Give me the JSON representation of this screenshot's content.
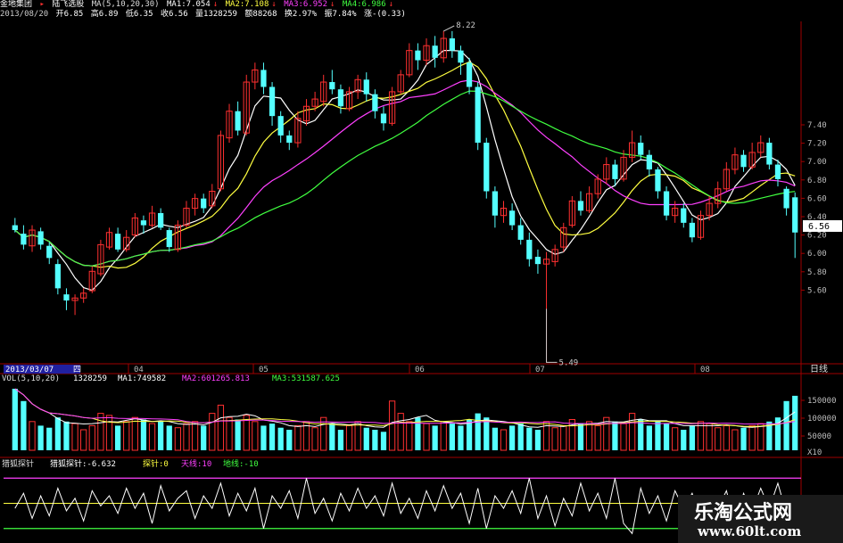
{
  "header": {
    "line1": {
      "name": "金地集团",
      "formula": "陆飞选股",
      "ma_spec": "MA(5,10,20,30)",
      "ma1": "MA1:7.054",
      "ma2": "MA2:7.108",
      "ma3": "MA3:6.952",
      "ma4": "MA4:6.986"
    },
    "line2": {
      "date": "2013/08/20",
      "open": "开6.85",
      "high": "高6.89",
      "low": "低6.35",
      "close": "收6.56",
      "vol": "量1328259",
      "amount": "额88268",
      "turnover": "换2.97%",
      "amplitude": "振7.84%",
      "change": "涨-(0.33)"
    }
  },
  "price_axis": {
    "ticks": [
      "7.40",
      "7.20",
      "7.00",
      "6.80",
      "6.60",
      "6.40",
      "6.20",
      "6.00",
      "5.80",
      "5.60"
    ],
    "current": "6.56"
  },
  "price_annotations": {
    "high": "8.22",
    "low": "5.49"
  },
  "time_axis": {
    "start": "2013/03/07",
    "weekday": "四",
    "months": [
      "04",
      "05",
      "06",
      "07",
      "08"
    ],
    "period": "日线"
  },
  "volume_panel": {
    "header": "VOL(5,10,20)",
    "vol": "1328259",
    "ma1": "MA1:749582",
    "ma2": "MA2:601265.813",
    "ma3": "MA3:531587.625",
    "ticks": [
      "150000",
      "100000",
      "50000"
    ],
    "unit": "X10"
  },
  "indicator_panel": {
    "name": "猎狐探针",
    "value": "猎狐探针:-6.632",
    "probe": "探针:0",
    "sky": "天线:10",
    "ground": "地线:-10"
  },
  "watermark": {
    "title": "乐淘公式网",
    "url": "www.60lt.com"
  },
  "colors": {
    "up": "#ff3030",
    "down": "#54ffff",
    "ma1": "#ffffff",
    "ma2": "#ffff40",
    "ma3": "#ff40ff",
    "ma4": "#40ff40",
    "label": "#ffff50",
    "axis": "#a00000"
  },
  "chart_data": {
    "type": "candlestick",
    "title": "金地集团 日线",
    "ylim": [
      5.5,
      8.3
    ],
    "candles": [
      [
        6.62,
        6.58,
        6.68,
        6.56
      ],
      [
        6.55,
        6.46,
        6.62,
        6.42
      ],
      [
        6.45,
        6.58,
        6.62,
        6.4
      ],
      [
        6.57,
        6.46,
        6.6,
        6.42
      ],
      [
        6.45,
        6.35,
        6.48,
        6.3
      ],
      [
        6.3,
        6.1,
        6.34,
        6.05
      ],
      [
        6.05,
        6.0,
        6.1,
        5.92
      ],
      [
        6.0,
        6.02,
        6.05,
        5.88
      ],
      [
        6.02,
        6.06,
        6.1,
        5.98
      ],
      [
        6.08,
        6.24,
        6.28,
        6.06
      ],
      [
        6.22,
        6.46,
        6.5,
        6.2
      ],
      [
        6.44,
        6.56,
        6.6,
        6.42
      ],
      [
        6.55,
        6.42,
        6.6,
        6.4
      ],
      [
        6.42,
        6.52,
        6.58,
        6.4
      ],
      [
        6.54,
        6.68,
        6.72,
        6.52
      ],
      [
        6.66,
        6.62,
        6.7,
        6.55
      ],
      [
        6.62,
        6.72,
        6.78,
        6.6
      ],
      [
        6.72,
        6.6,
        6.76,
        6.58
      ],
      [
        6.58,
        6.44,
        6.6,
        6.4
      ],
      [
        6.42,
        6.62,
        6.66,
        6.4
      ],
      [
        6.62,
        6.76,
        6.82,
        6.6
      ],
      [
        6.76,
        6.84,
        6.88,
        6.7
      ],
      [
        6.84,
        6.76,
        6.88,
        6.72
      ],
      [
        6.78,
        6.9,
        6.96,
        6.76
      ],
      [
        6.92,
        7.36,
        7.4,
        6.9
      ],
      [
        7.34,
        7.56,
        7.62,
        7.3
      ],
      [
        7.56,
        7.4,
        7.64,
        7.36
      ],
      [
        7.38,
        7.8,
        7.86,
        7.36
      ],
      [
        7.8,
        7.9,
        7.96,
        7.74
      ],
      [
        7.9,
        7.76,
        7.96,
        7.7
      ],
      [
        7.76,
        7.52,
        7.8,
        7.44
      ],
      [
        7.52,
        7.36,
        7.56,
        7.3
      ],
      [
        7.36,
        7.3,
        7.4,
        7.24
      ],
      [
        7.3,
        7.5,
        7.56,
        7.26
      ],
      [
        7.48,
        7.6,
        7.66,
        7.44
      ],
      [
        7.6,
        7.66,
        7.72,
        7.56
      ],
      [
        7.64,
        7.8,
        7.86,
        7.6
      ],
      [
        7.8,
        7.74,
        7.9,
        7.7
      ],
      [
        7.74,
        7.6,
        7.78,
        7.54
      ],
      [
        7.58,
        7.72,
        7.76,
        7.56
      ],
      [
        7.72,
        7.82,
        7.86,
        7.66
      ],
      [
        7.82,
        7.7,
        7.88,
        7.64
      ],
      [
        7.7,
        7.56,
        7.74,
        7.5
      ],
      [
        7.54,
        7.46,
        7.6,
        7.4
      ],
      [
        7.46,
        7.72,
        7.76,
        7.44
      ],
      [
        7.72,
        7.86,
        7.9,
        7.7
      ],
      [
        7.86,
        8.06,
        8.12,
        7.84
      ],
      [
        8.06,
        7.98,
        8.12,
        7.9
      ],
      [
        7.98,
        8.1,
        8.16,
        7.94
      ],
      [
        8.1,
        8.0,
        8.18,
        7.92
      ],
      [
        8.0,
        8.16,
        8.22,
        7.96
      ],
      [
        8.16,
        8.06,
        8.22,
        8.0
      ],
      [
        8.06,
        7.96,
        8.1,
        7.86
      ],
      [
        7.96,
        7.76,
        8.0,
        7.7
      ],
      [
        7.76,
        7.3,
        7.8,
        7.24
      ],
      [
        7.3,
        6.9,
        7.34,
        6.84
      ],
      [
        6.9,
        6.7,
        6.94,
        6.6
      ],
      [
        6.7,
        6.76,
        6.82,
        6.64
      ],
      [
        6.74,
        6.62,
        6.8,
        6.58
      ],
      [
        6.62,
        6.5,
        6.68,
        6.46
      ],
      [
        6.5,
        6.34,
        6.56,
        6.28
      ],
      [
        6.36,
        6.3,
        6.42,
        6.22
      ],
      [
        6.3,
        6.34,
        6.4,
        5.49
      ],
      [
        6.32,
        6.42,
        6.46,
        6.28
      ],
      [
        6.44,
        6.6,
        6.64,
        6.4
      ],
      [
        6.62,
        6.82,
        6.86,
        6.6
      ],
      [
        6.82,
        6.74,
        6.9,
        6.7
      ],
      [
        6.74,
        6.88,
        6.94,
        6.72
      ],
      [
        6.88,
        7.0,
        7.04,
        6.84
      ],
      [
        7.0,
        7.12,
        7.18,
        6.96
      ],
      [
        7.12,
        7.0,
        7.16,
        6.94
      ],
      [
        7.0,
        7.18,
        7.24,
        6.98
      ],
      [
        7.18,
        7.3,
        7.4,
        7.14
      ],
      [
        7.3,
        7.2,
        7.36,
        7.16
      ],
      [
        7.2,
        7.08,
        7.24,
        7.02
      ],
      [
        7.08,
        6.9,
        7.1,
        6.84
      ],
      [
        6.9,
        6.7,
        6.94,
        6.66
      ],
      [
        6.7,
        6.76,
        6.82,
        6.64
      ],
      [
        6.76,
        6.64,
        6.8,
        6.6
      ],
      [
        6.64,
        6.52,
        6.68,
        6.48
      ],
      [
        6.52,
        6.7,
        6.74,
        6.5
      ],
      [
        6.7,
        6.8,
        6.86,
        6.66
      ],
      [
        6.8,
        6.92,
        6.98,
        6.76
      ],
      [
        6.92,
        7.08,
        7.14,
        6.9
      ],
      [
        7.08,
        7.2,
        7.26,
        7.04
      ],
      [
        7.2,
        7.1,
        7.24,
        7.06
      ],
      [
        7.1,
        7.22,
        7.3,
        7.08
      ],
      [
        7.22,
        7.3,
        7.36,
        7.18
      ],
      [
        7.3,
        7.12,
        7.34,
        7.08
      ],
      [
        7.12,
        7.0,
        7.16,
        6.94
      ],
      [
        6.92,
        6.76,
        6.94,
        6.7
      ],
      [
        6.85,
        6.56,
        6.89,
        6.35
      ]
    ],
    "volumes": [
      1500000,
      1200000,
      700000,
      600000,
      550000,
      800000,
      700000,
      650000,
      500000,
      600000,
      900000,
      850000,
      600000,
      700000,
      800000,
      750000,
      650000,
      700000,
      600000,
      550000,
      650000,
      700000,
      600000,
      900000,
      1100000,
      800000,
      750000,
      850000,
      700000,
      600000,
      650000,
      550000,
      500000,
      600000,
      700000,
      550000,
      800000,
      650000,
      500000,
      600000,
      700000,
      550000,
      500000,
      450000,
      1200000,
      900000,
      700000,
      800000,
      650000,
      600000,
      700000,
      650000,
      600000,
      750000,
      900000,
      800000,
      550000,
      500000,
      600000,
      650000,
      550000,
      500000,
      700000,
      550000,
      600000,
      750000,
      650000,
      700000,
      600000,
      800000,
      700000,
      650000,
      900000,
      750000,
      600000,
      700000,
      650000,
      550000,
      500000,
      600000,
      700000,
      650000,
      550000,
      600000,
      500000,
      550000,
      600000,
      650000,
      700000,
      800000,
      1200000,
      1328259
    ],
    "probe": [
      -2,
      4,
      -6,
      3,
      -5,
      6,
      -3,
      2,
      -7,
      5,
      -1,
      3,
      -4,
      6,
      -2,
      4,
      -8,
      7,
      -3,
      2,
      5,
      -6,
      3,
      -2,
      8,
      -5,
      4,
      -3,
      6,
      -10,
      3,
      -2,
      5,
      -6,
      10,
      -4,
      2,
      -7,
      4,
      -3,
      6,
      -2,
      3,
      -5,
      8,
      -4,
      2,
      -6,
      5,
      -3,
      7,
      -2,
      4,
      -8,
      6,
      -10,
      3,
      -2,
      5,
      -4,
      10,
      -6,
      3,
      -9,
      2,
      -5,
      8,
      -3,
      4,
      -6,
      10,
      -8,
      -12,
      6,
      -4,
      3,
      -7,
      5,
      -2,
      4,
      -6,
      3,
      -2,
      5,
      -8,
      4,
      -3,
      6,
      -2,
      8,
      -4,
      -6.632
    ]
  }
}
